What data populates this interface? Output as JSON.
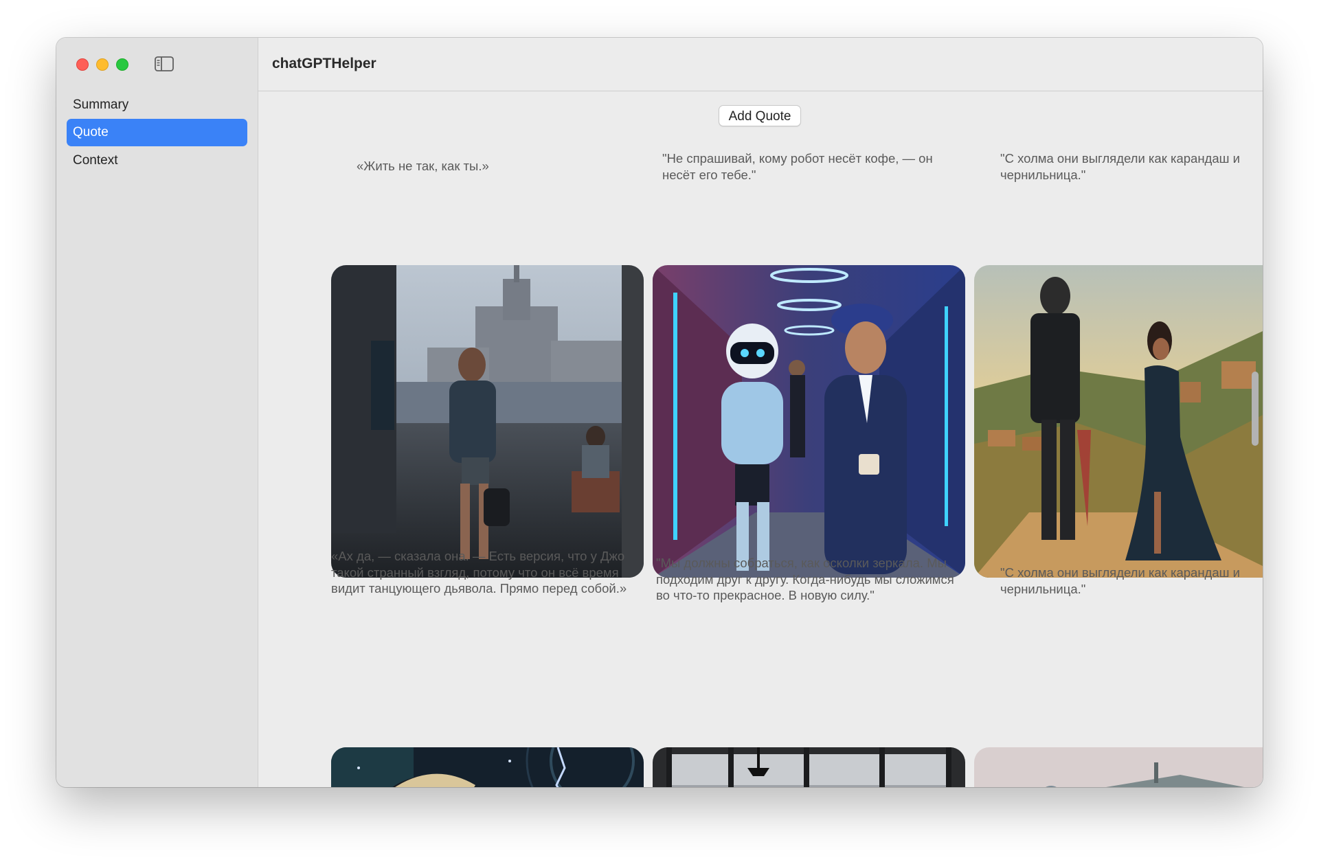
{
  "window": {
    "app_title": "chatGPTHelper"
  },
  "sidebar": {
    "items": [
      {
        "label": "Summary",
        "selected": false
      },
      {
        "label": "Quote",
        "selected": true
      },
      {
        "label": "Context",
        "selected": false
      }
    ],
    "accent": "#3a82f7"
  },
  "toolbar": {
    "add_quote_label": "Add Quote"
  },
  "quotes": [
    {
      "text": "«Жить не так, как ты.»",
      "image": "woman walking out of doorway with moscow skyscraper behind"
    },
    {
      "text": "\"Не спрашивай, кому робот несёт кофе, — он несёт его тебе.\"",
      "image": "robot and woman holding coffee in neon corridor"
    },
    {
      "text": "\"С холма они выглядели как карандаш и чернильница.\"",
      "image": "robot in suit and woman in dress on hill at sunset"
    },
    {
      "text": "«Ах да, — сказала она. — Есть версия, что у Джо такой странный взгляд, потому что он всё время видит танцующего дьявола. Прямо перед собой.»",
      "image": "person with lightning in dark gothic space"
    },
    {
      "text": "\"Мы должны собраться, как осколки зеркала. Мы подходим друг к другу. Когда-нибудь мы сложимся во что-то прекрасное. В новую силу.\"",
      "image": "loft window with cloudy sky"
    },
    {
      "text": "\"С холма они выглядели как карандаш и чернильница.\"",
      "image": "robot on hill with distant town"
    }
  ]
}
